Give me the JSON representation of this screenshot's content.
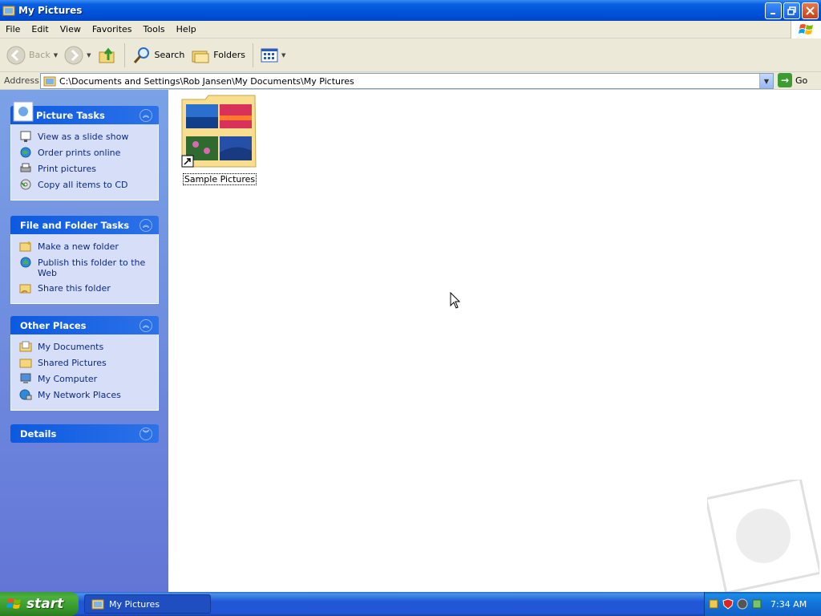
{
  "window": {
    "title": "My Pictures"
  },
  "menu": [
    "File",
    "Edit",
    "View",
    "Favorites",
    "Tools",
    "Help"
  ],
  "toolbar": {
    "back": "Back",
    "search": "Search",
    "folders": "Folders"
  },
  "address": {
    "label": "Address",
    "value": "C:\\Documents and Settings\\Rob Jansen\\My Documents\\My Pictures",
    "go": "Go"
  },
  "panels": {
    "picture_tasks": {
      "title": "Picture Tasks",
      "items": [
        "View as a slide show",
        "Order prints online",
        "Print pictures",
        "Copy all items to CD"
      ]
    },
    "file_folder_tasks": {
      "title": "File and Folder Tasks",
      "items": [
        "Make a new folder",
        "Publish this folder to the Web",
        "Share this folder"
      ]
    },
    "other_places": {
      "title": "Other Places",
      "items": [
        "My Documents",
        "Shared Pictures",
        "My Computer",
        "My Network Places"
      ]
    },
    "details": {
      "title": "Details"
    }
  },
  "content": {
    "items": [
      {
        "label": "Sample Pictures"
      }
    ]
  },
  "taskbar": {
    "start": "start",
    "window_button": "My Pictures",
    "clock": "7:34 AM"
  }
}
